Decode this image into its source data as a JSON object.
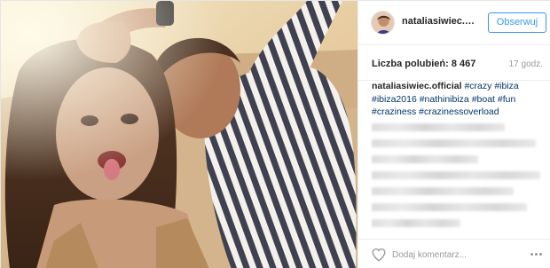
{
  "post": {
    "username": "nataliasiwiec.offi...",
    "follow_label": "Obserwuj",
    "likes_label": "Liczba polubień:",
    "likes_count": "8 467",
    "time_ago": "17 godz."
  },
  "caption": {
    "author": "nataliasiwiec.official",
    "hashtags_line1": [
      "#crazy",
      "#ibiza"
    ],
    "hashtags_line2": [
      "#ibiza2016",
      "#nathinibiza",
      "#boat",
      "#fun"
    ],
    "hashtags_line3": [
      "#craziness",
      "#crazinessoverload"
    ],
    "blurred_comment_lines": 7
  },
  "footer": {
    "comment_placeholder": "Dodaj komentarz..."
  },
  "icons": {
    "like": "heart-icon",
    "more": "more-options-icon"
  },
  "colors": {
    "link_blue": "#3897f0",
    "hashtag_blue": "#003569",
    "muted_gray": "#999999"
  }
}
